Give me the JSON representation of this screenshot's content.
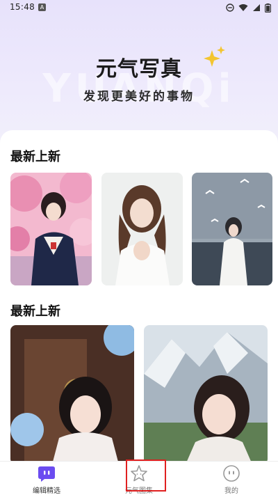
{
  "status_bar": {
    "time": "15:48",
    "app_badge": "A"
  },
  "hero": {
    "title": "元气写真",
    "subtitle": "发现更美好的事物",
    "watermark": "YUANQi"
  },
  "sections": [
    {
      "title": "最新上新"
    },
    {
      "title": "最新上新"
    }
  ],
  "nav": {
    "items": [
      {
        "label": "编辑精选",
        "icon": "chat-bubble-icon",
        "active": true
      },
      {
        "label": "元气图集",
        "icon": "star-icon",
        "active": false
      },
      {
        "label": "我的",
        "icon": "face-icon",
        "active": false
      }
    ]
  },
  "colors": {
    "accent": "#6b4cf0",
    "highlight": "#e02020",
    "sparkle": "#f3c530"
  }
}
